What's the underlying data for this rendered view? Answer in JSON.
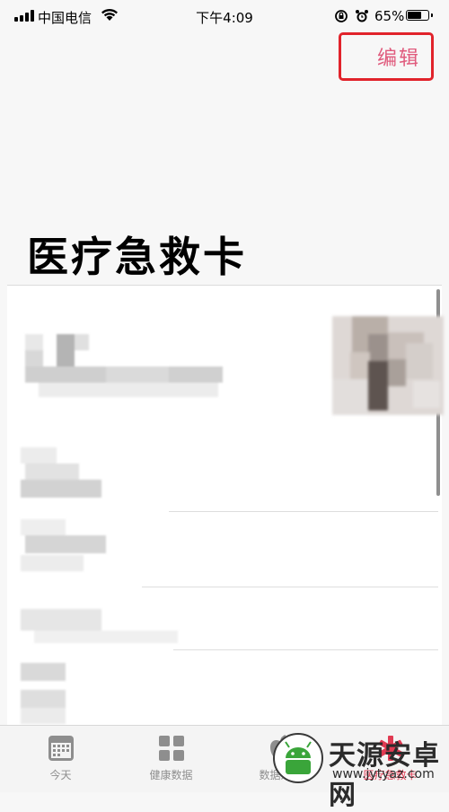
{
  "status_bar": {
    "carrier": "中国电信",
    "time": "下午4:09",
    "battery": "65%"
  },
  "header": {
    "edit_label": "编辑",
    "highlight_color": "#e1232b"
  },
  "page": {
    "title": "医疗急救卡"
  },
  "tabs": [
    {
      "label": "今天",
      "icon": "calendar-icon"
    },
    {
      "label": "健康数据",
      "icon": "grid-icon"
    },
    {
      "label": "数据来源",
      "icon": "apple-icon"
    },
    {
      "label": "医疗急救卡",
      "icon": "medical-asterisk-icon",
      "active": true
    }
  ],
  "watermark": {
    "title": "天源安卓网",
    "url": "www.jytyaz.com"
  },
  "colors": {
    "accent": "#e05b7d",
    "active_tab": "#e03a52"
  }
}
